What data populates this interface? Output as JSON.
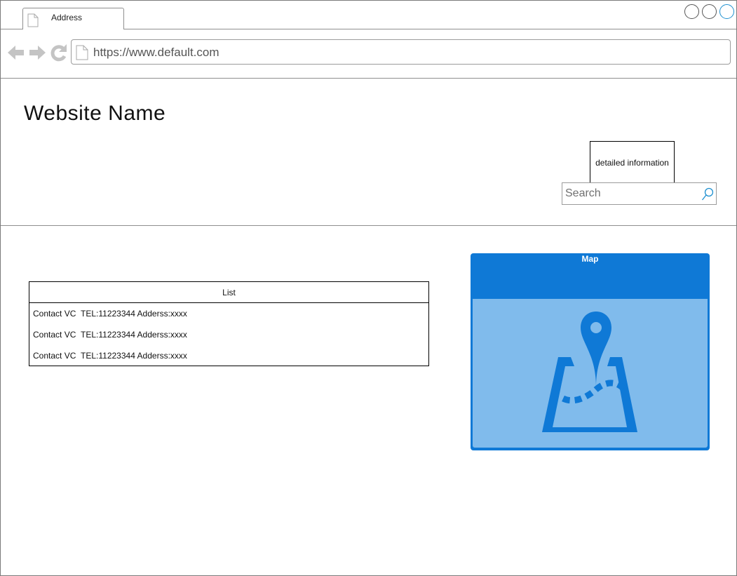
{
  "browser": {
    "tab_label": "Address",
    "url": "https://www.default.com",
    "icons": [
      "page-icon",
      "back-arrow-icon",
      "forward-arrow-icon",
      "reload-icon",
      "minimize-icon",
      "restore-icon",
      "close-icon"
    ]
  },
  "header": {
    "site_name": "Website Name",
    "detail_button": "detailed information",
    "search": {
      "placeholder": "Search",
      "value": ""
    }
  },
  "list": {
    "title": "List",
    "items": [
      {
        "name": "Contact VC",
        "tel": "TEL:11223344",
        "address": "Adderss:xxxx"
      },
      {
        "name": "Contact VC",
        "tel": "TEL:11223344",
        "address": "Adderss:xxxx"
      },
      {
        "name": "Contact VC",
        "tel": "TEL:11223344",
        "address": "Adderss:xxxx"
      }
    ]
  },
  "map": {
    "title": "Map",
    "icon": "map-pin-icon",
    "colors": {
      "header": "#0f79d6",
      "body": "#80bbec",
      "icon": "#0f79d6"
    }
  }
}
